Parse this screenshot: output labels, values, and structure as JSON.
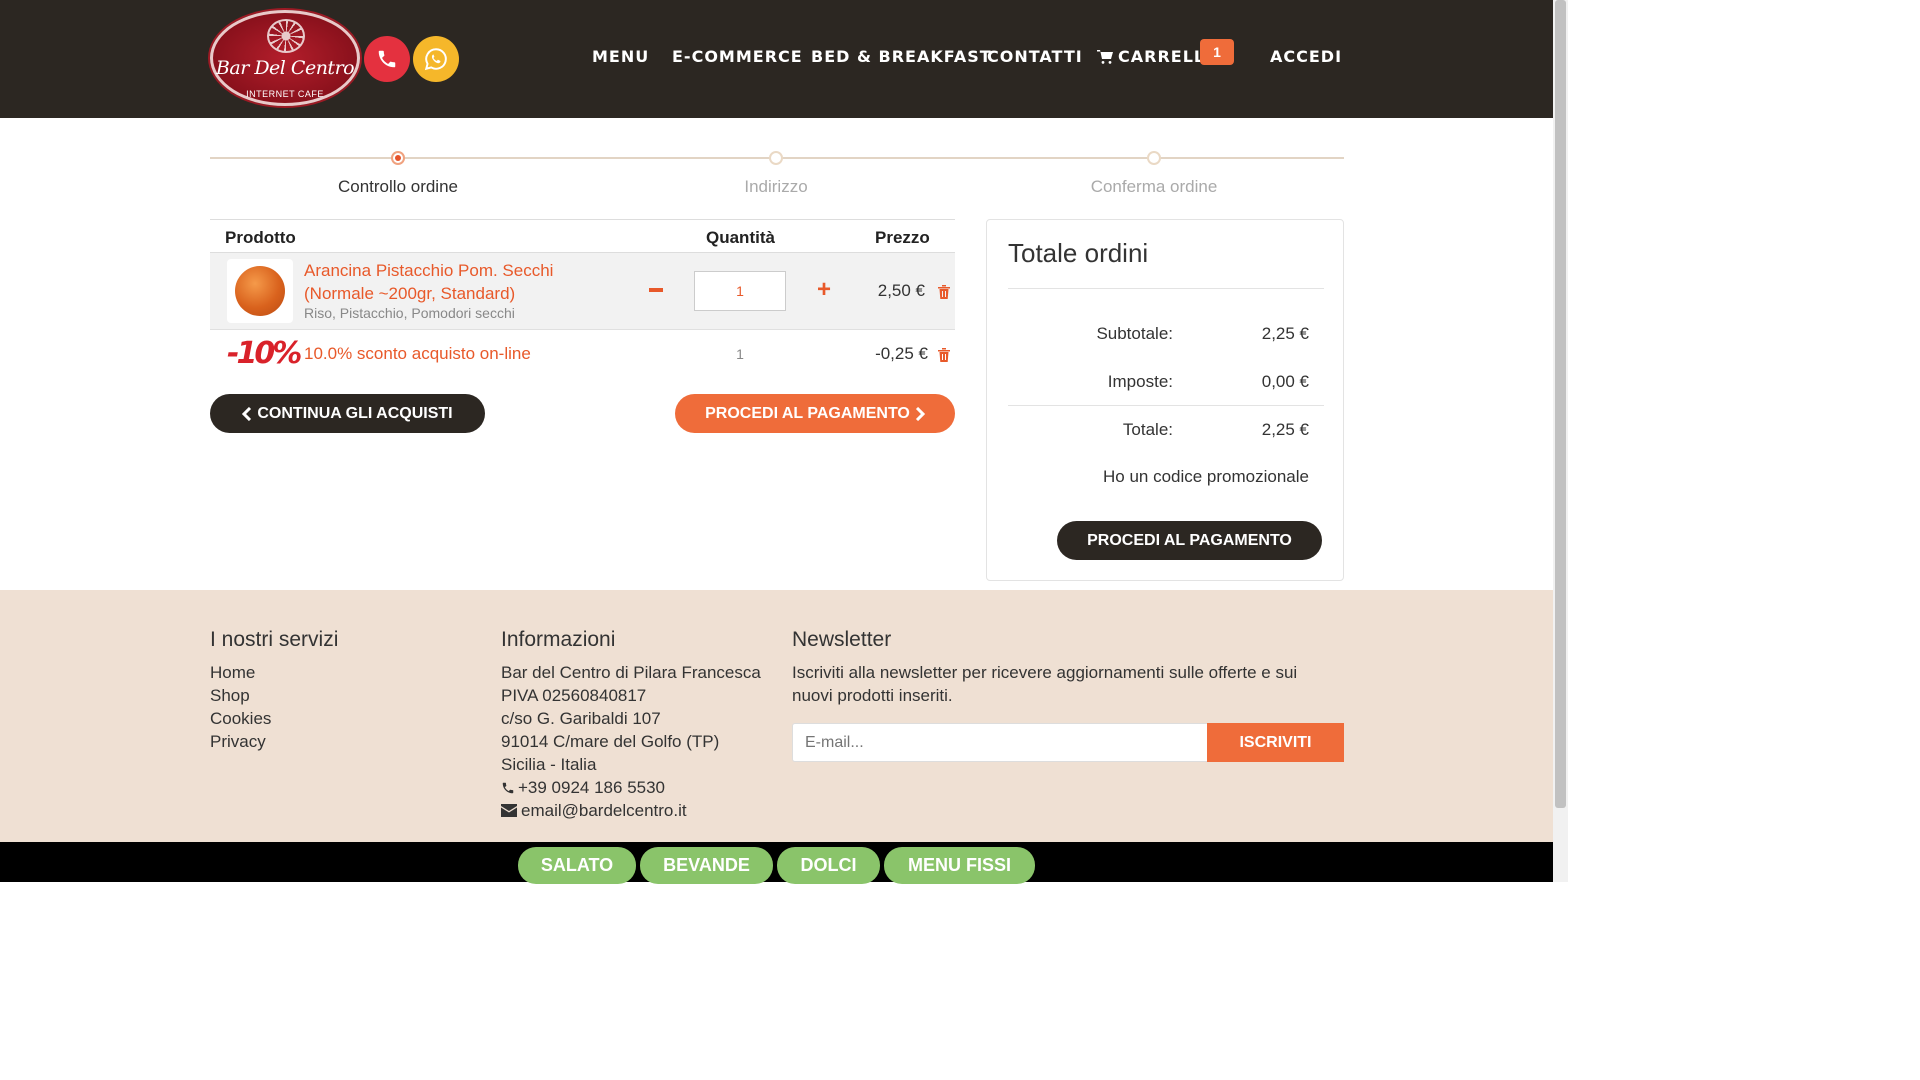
{
  "header": {
    "logo_text": "Bar Del Centro",
    "logo_sub": "INTERNET CAFE",
    "nav": [
      "MENU",
      "E-COMMERCE",
      "BED & BREAKFAST",
      "CONTATTI",
      "CARRELLO",
      "ACCEDI"
    ],
    "cart_count": "1",
    "phone_color": "#e4313f",
    "whatsapp_color": "#f5b72a"
  },
  "steps": [
    "Controllo ordine",
    "Indirizzo",
    "Conferma ordine"
  ],
  "cart": {
    "headers": {
      "product": "Prodotto",
      "quantity": "Quantità",
      "price": "Prezzo"
    },
    "items": [
      {
        "name": "Arancina Pistacchio Pom. Secchi (Normale ~200gr, Standard)",
        "description": "Riso, Pistacchio, Pomodori secchi",
        "quantity": "1",
        "price": "2,50 €"
      }
    ],
    "discount": {
      "badge": "-10%",
      "name": "10.0% sconto acquisto on-line",
      "quantity": "1",
      "price": "-0,25 €"
    },
    "continue_label": "CONTINUA GLI ACQUISTI",
    "proceed_label": "PROCEDI AL PAGAMENTO"
  },
  "totals": {
    "title": "Totale ordini",
    "subtotal_label": "Subtotale:",
    "subtotal": "2,25 €",
    "tax_label": "Imposte:",
    "tax": "0,00 €",
    "total_label": "Totale:",
    "total": "2,25 €",
    "promo": "Ho un codice promozionale",
    "pay_label": "PROCEDI AL PAGAMENTO"
  },
  "footer": {
    "services_title": "I nostri servizi",
    "services": [
      "Home",
      "Shop",
      "Cookies",
      "Privacy"
    ],
    "info_title": "Informazioni",
    "info": [
      "Bar del Centro di Pilara Francesca",
      "PIVA 02560840817",
      "c/so G. Garibaldi 107",
      "91014 C/mare del Golfo (TP)",
      "Sicilia - Italia"
    ],
    "phone": "+39 0924 186 5530",
    "email": "email@bardelcentro.it",
    "newsletter_title": "Newsletter",
    "newsletter_text_1": "Iscriviti alla newsletter per ricevere aggiornamenti sulle offerte e sui",
    "newsletter_text_2": "nuovi prodotti inseriti.",
    "email_placeholder": "E-mail...",
    "subscribe_label": "ISCRIVITI"
  },
  "bottom_menu": [
    "SALATO",
    "BEVANDE",
    "DOLCI",
    "MENU FISSI"
  ],
  "colors": {
    "accent": "#ef6c3a",
    "dark": "#2c2722",
    "footer_bg": "#efe0d3",
    "pill": "#8ac46a"
  }
}
